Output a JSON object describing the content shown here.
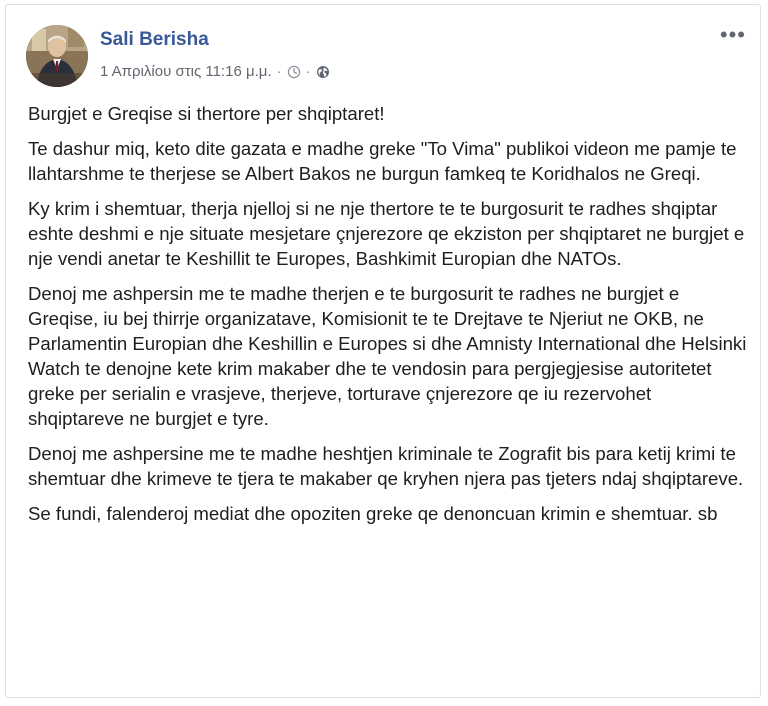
{
  "post": {
    "author": "Sali Berisha",
    "timestamp": "1 Απριλίου στις 11:16 μ.μ.",
    "meta_separator": "·",
    "icons": {
      "avatar": "profile-photo",
      "clock": "clock-icon",
      "audience": "globe-icon",
      "options": "more-options-icon"
    },
    "options_label": "•••",
    "paragraphs": [
      "Burgjet e Greqise si thertore per shqiptaret!",
      "Te dashur miq, keto dite gazata e madhe greke \"To Vima\" publikoi videon me pamje te llahtarshme te therjese se Albert Bakos ne burgun famkeq te Koridhalos ne Greqi.",
      "Ky krim i shemtuar, therja njelloj si ne nje thertore te te burgosurit te radhes shqiptar eshte deshmi e nje situate mesjetare çnjerezore qe ekziston per shqiptaret ne burgjet e nje vendi anetar te Keshillit te Europes, Bashkimit Europian dhe NATOs.",
      "Denoj me ashpersin me te madhe therjen e te burgosurit te radhes ne burgjet e Greqise, iu bej thirrje organizatave, Komisionit te te Drejtave te Njeriut ne OKB, ne Parlamentin Europian dhe Keshillin e Europes si dhe Amnisty International dhe Helsinki Watch te denojne kete krim makaber dhe te vendosin para pergjegjesise autoritetet greke per serialin e vrasjeve, therjeve, torturave çnjerezore qe iu rezervohet shqiptareve ne burgjet e tyre.",
      "Denoj me ashpersine me te madhe heshtjen kriminale te Zografit bis para ketij krimi te shemtuar dhe krimeve te tjera te makaber qe kryhen njera pas tjeters ndaj shqiptareve.",
      "Se fundi, falenderoj mediat dhe opoziten greke qe denoncuan krimin e shemtuar. sb"
    ]
  },
  "colors": {
    "author_link": "#385898",
    "meta_text": "#616770",
    "body_text": "#1c1e21",
    "card_border": "#dddfe2"
  }
}
